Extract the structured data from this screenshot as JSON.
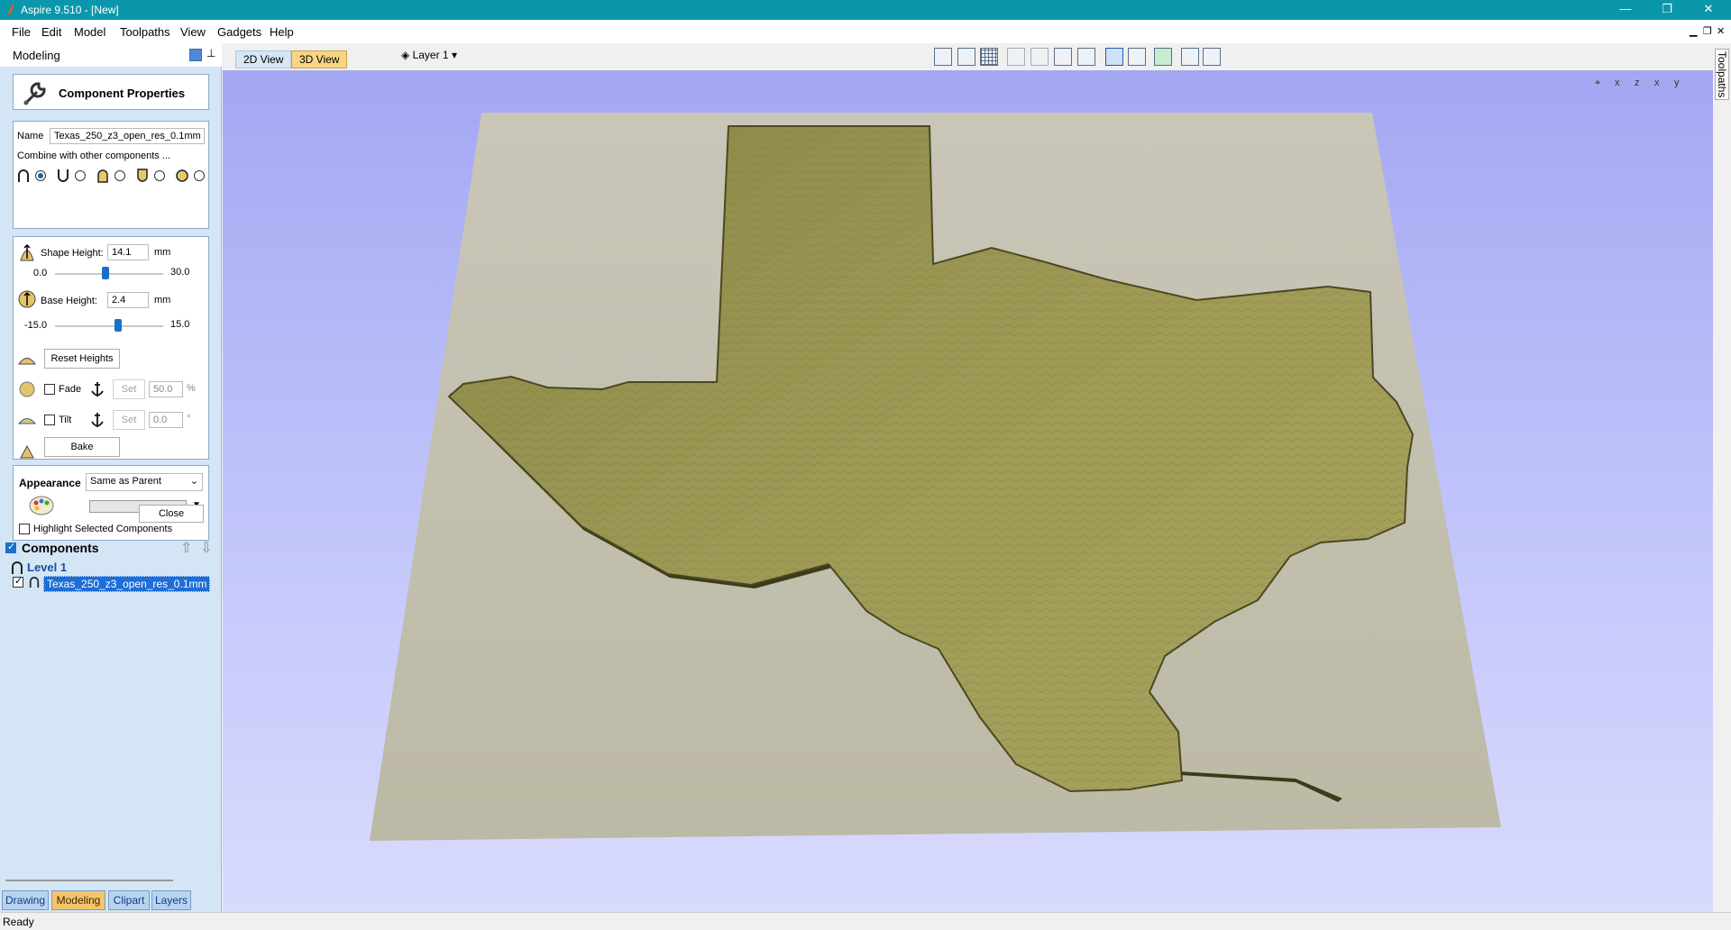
{
  "window": {
    "title": "Aspire 9.510 - [New]",
    "controls": [
      "—",
      "❐",
      "✕"
    ]
  },
  "menu": [
    "File",
    "Edit",
    "Model",
    "Toolpaths",
    "View",
    "Gadgets",
    "Help"
  ],
  "mdi_controls": [
    "▁",
    "❐",
    "✕"
  ],
  "panel": {
    "title": "Modeling",
    "component_properties": {
      "title": "Component Properties",
      "name_label": "Name",
      "name_value": "Texas_250_z3_open_res_0.1mm",
      "combine_label": "Combine with other components ...",
      "combine_modes": [
        "add",
        "subtract",
        "merge",
        "multiply"
      ],
      "combine_selected": 0
    },
    "shape_height": {
      "label": "Shape Height:",
      "value": "14.1",
      "unit": "mm",
      "min": "0.0",
      "max": "30.0",
      "fraction": 0.47
    },
    "base_height": {
      "label": "Base Height:",
      "value": "2.4",
      "unit": "mm",
      "min": "-15.0",
      "max": "15.0",
      "fraction": 0.58
    },
    "reset_heights": "Reset Heights",
    "fade": {
      "label": "Fade",
      "set": "Set",
      "value": "50.0",
      "unit": "%"
    },
    "tilt": {
      "label": "Tilt",
      "set": "Set",
      "value": "0.0",
      "unit": "°"
    },
    "bake": "Bake",
    "appearance": {
      "label": "Appearance",
      "selected": "Same as Parent",
      "highlight_label": "Highlight Selected Components"
    },
    "close": "Close"
  },
  "components": {
    "title": "Components",
    "level": "Level 1",
    "item": "Texas_250_z3_open_res_0.1mm"
  },
  "bottom_tabs": [
    "Drawing",
    "Modeling",
    "Clipart",
    "Layers"
  ],
  "bottom_tabs_active": 1,
  "view_tabs": [
    "2D View",
    "3D View"
  ],
  "view_tab_active": 1,
  "layer": "Layer 1",
  "axis_buttons": [
    "⌖",
    "x",
    "z",
    "x",
    "y"
  ],
  "right_tab": "Toolpaths",
  "status": "Ready",
  "colors": {
    "titlebar": "#0b97ab",
    "model": "#9a974f",
    "base_plane": "#c2bfa8",
    "background_top": "#a3a7f2"
  }
}
